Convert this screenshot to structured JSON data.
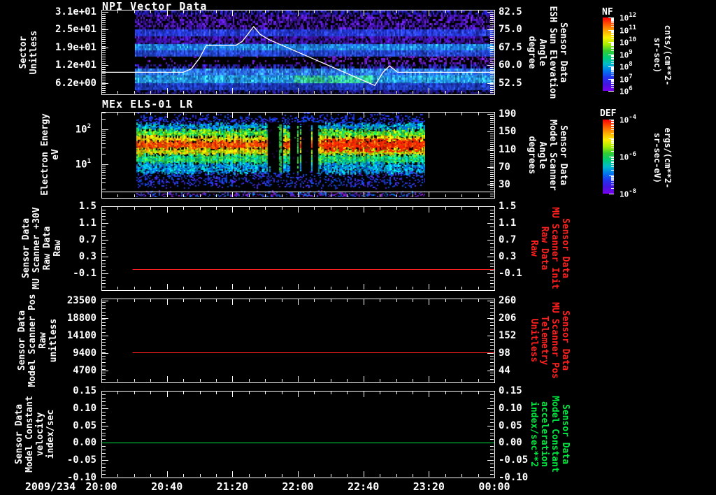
{
  "xaxis": {
    "date_label": "2009/234",
    "tick_labels": [
      "20:00",
      "20:40",
      "21:20",
      "22:00",
      "22:40",
      "23:20",
      "00:00"
    ],
    "tick_minutes": [
      0,
      40,
      80,
      120,
      160,
      200,
      240
    ]
  },
  "panels": [
    {
      "title": "NPI Vector Data",
      "left_label": "Sector\nUnitless",
      "left_ticks": [
        "3.1e+01",
        "2.5e+01",
        "1.9e+01",
        "1.2e+01",
        "6.2e+00"
      ],
      "right_ticks": [
        "82.5",
        "75.0",
        "67.5",
        "60.0",
        "52.5"
      ],
      "right_label": "Sensor Data\nESH Sun Elevation\nAngle\ndegree",
      "right_label_color": "#ffffff"
    },
    {
      "title": "MEx ELS-01 LR",
      "left_label": "Electron Energy\neV",
      "left_ticks": [
        "10^2",
        "10^1"
      ],
      "right_ticks": [
        "190",
        "150",
        "110",
        "70",
        "30"
      ],
      "right_label": "Sensor Data\nModel Scanner\nAngle\ndegrees",
      "right_label_color": "#ffffff"
    },
    {
      "left_label": "Sensor Data\nMU Scanner +30V\nRaw Data\nRaw",
      "left_ticks": [
        "1.5",
        "1.1",
        "0.7",
        "0.3",
        "-0.1"
      ],
      "right_ticks": [
        "1.5",
        "1.1",
        "0.7",
        "0.3",
        "-0.1"
      ],
      "right_label": "Sensor Data\nMU Scanner Init\nRaw Data\nRaw",
      "right_label_color": "#ff2020"
    },
    {
      "left_label": "Sensor Data\nModel Scanner Pos\nRaw\nunitless",
      "left_ticks": [
        "23500",
        "18800",
        "14100",
        "9400",
        "4700"
      ],
      "right_ticks": [
        "260",
        "206",
        "152",
        "98",
        "44"
      ],
      "right_label": "Sensor Data\nMU Scanner Pos\nTelemetry\nUnitless",
      "right_label_color": "#ff2020"
    },
    {
      "left_label": "Sensor Data\nModel Constant\nvelocity\nindex/sec",
      "left_ticks": [
        "0.15",
        "0.10",
        "0.05",
        "0.00",
        "-0.05",
        "-0.10"
      ],
      "right_ticks": [
        "0.15",
        "0.10",
        "0.05",
        "0.00",
        "-0.05",
        "-0.10"
      ],
      "right_label": "Sensor Data\nModel Constant\nacceleration\nindex/sec**2",
      "right_label_color": "#00e840"
    }
  ],
  "colorbars": [
    {
      "title": "NF",
      "ticks": [
        "10^12",
        "10^11",
        "10^10",
        "10^9",
        "10^8",
        "10^7",
        "10^6"
      ],
      "unit": "cnts/(cm**2-sr-sec)",
      "palette": [
        "#7a00ee",
        "#4414dd",
        "#2233ee",
        "#0077ee",
        "#00bbcc",
        "#00cc77",
        "#33cc33",
        "#aaee00",
        "#ffee00",
        "#ffaa00",
        "#ff5500",
        "#ff0000"
      ]
    },
    {
      "title": "DEF",
      "ticks": [
        "10^-4",
        "10^-6",
        "10^-8"
      ],
      "unit": "ergs/(cm**2-sr-sec-eV)",
      "palette": [
        "#7a00ee",
        "#4414dd",
        "#2233ee",
        "#0077ee",
        "#00bbcc",
        "#00cc77",
        "#33cc33",
        "#aaee00",
        "#ffee00",
        "#ffaa00",
        "#ff5500",
        "#ff0000"
      ]
    }
  ],
  "chart_data": [
    {
      "type": "heatmap",
      "title": "NPI Vector Data",
      "xlabel_date": "2009/234",
      "x_ticks": [
        "20:00",
        "20:40",
        "21:20",
        "22:00",
        "22:40",
        "23:20",
        "00:00"
      ],
      "ylabel": "Sector Unitless",
      "y_ticks": [
        6.2,
        12,
        19,
        25,
        31
      ],
      "colorbar": {
        "name": "NF",
        "unit": "cnts/(cm**2-sr-sec)",
        "ticks": [
          1000000.0,
          10000000.0,
          100000000.0,
          1000000000.0,
          10000000000.0,
          100000000000.0,
          1000000000000.0
        ]
      },
      "data_start": "20:20",
      "data_end": "00:00",
      "bands": [
        {
          "f0": 0.0,
          "f1": 0.05,
          "colors": [
            "#2a23c8",
            "#1a14a0",
            "#000000"
          ],
          "density": 0.9
        },
        {
          "f0": 0.05,
          "f1": 0.225,
          "colors": [
            "#4a14b4",
            "#5d1ed0",
            "#2e0c86",
            "#000000",
            "#000000"
          ],
          "density": 1
        },
        {
          "f0": 0.225,
          "f1": 0.315,
          "colors": [
            "#2336d6",
            "#1e2cb8",
            "#2f49e8"
          ],
          "density": 1
        },
        {
          "f0": 0.315,
          "f1": 0.4,
          "colors": [
            "#3d12a6",
            "#4c18c4",
            "#270a74",
            "#000000"
          ],
          "density": 1
        },
        {
          "f0": 0.4,
          "f1": 0.475,
          "colors": [
            "#1f7fe8",
            "#1b65d8",
            "#27a0f0"
          ],
          "density": 1
        },
        {
          "f0": 0.475,
          "f1": 0.55,
          "colors": [
            "#2243cc",
            "#1b34b0",
            "#2a52e0"
          ],
          "density": 1
        },
        {
          "f0": 0.55,
          "f1": 0.645,
          "colors": [
            "#5a14b0",
            "#6a1ecc"
          ],
          "density": 0.08,
          "density2": 0.4
        },
        {
          "f0": 0.645,
          "f1": 0.7,
          "colors": [
            "#3a10a0",
            "#2233bb",
            "#000000"
          ],
          "density": 0.85
        },
        {
          "f0": 0.7,
          "f1": 0.78,
          "colors": [
            "#2b6ff0",
            "#2450d8",
            "#35a0f8"
          ],
          "density": 1
        },
        {
          "f0": 0.78,
          "f1": 0.87,
          "colors": [
            "#2090e0",
            "#1b72d0",
            "#30b8e8"
          ],
          "density": 1,
          "blob": {
            "t0": 0.44,
            "t1": 0.66,
            "color": "#38d892"
          }
        },
        {
          "f0": 0.87,
          "f1": 0.955,
          "colors": [
            "#1c3ab8",
            "#16289c",
            "#2446cc"
          ],
          "density": 1
        },
        {
          "f0": 0.955,
          "f1": 1.0,
          "colors": [
            "#2a1c9c",
            "#17107c",
            "#000000"
          ],
          "density": 0.9
        }
      ],
      "overlay_line": {
        "name": "Sensor Data ESH Sun Elevation Angle (degree)",
        "color": "#ffffff",
        "y_ticks": [
          52.5,
          60.0,
          67.5,
          75.0,
          82.5
        ],
        "points_min_deg": [
          [
            0,
            57
          ],
          [
            50,
            57
          ],
          [
            55,
            58.5
          ],
          [
            60,
            63
          ],
          [
            64,
            68.3
          ],
          [
            82,
            68.3
          ],
          [
            86,
            70
          ],
          [
            93,
            76.3
          ],
          [
            97,
            73
          ],
          [
            102,
            70.9
          ],
          [
            167,
            51.4
          ],
          [
            172,
            57
          ],
          [
            176,
            59.7
          ],
          [
            181,
            57
          ],
          [
            240,
            57
          ]
        ]
      }
    },
    {
      "type": "heatmap",
      "title": "MEx ELS-01 LR",
      "ylabel": "Electron Energy (eV)",
      "yscale": "log",
      "y_ticks": [
        10,
        100
      ],
      "right_axis": {
        "name": "Sensor Data Model Scanner Angle (degrees)",
        "ticks": [
          30,
          70,
          110,
          150,
          190
        ]
      },
      "colorbar": {
        "name": "DEF",
        "unit": "ergs/(cm**2-sr-sec-eV)",
        "ticks": [
          1e-08,
          1e-06,
          0.0001
        ]
      },
      "data_start": "20:21",
      "data_end": "23:18",
      "overlay_line_eV": 1.7,
      "bands": [
        {
          "f0": 0.0,
          "f1": 0.055,
          "colors": [
            "#2233ee",
            "#1a2ccc"
          ],
          "density": 0.12
        },
        {
          "f0": 0.055,
          "f1": 0.135,
          "colors": [
            "#2233ee",
            "#0044cc",
            "#3322dd"
          ],
          "density": 0.45
        },
        {
          "f0": 0.135,
          "f1": 0.205,
          "colors": [
            "#0077dd",
            "#00aacc",
            "#0055ee",
            "#00ccaa"
          ],
          "density": 0.92
        },
        {
          "f0": 0.205,
          "f1": 0.285,
          "colors": [
            "#22cc44",
            "#66dd11",
            "#00cc77",
            "#aaee00"
          ],
          "density": 1
        },
        {
          "f0": 0.285,
          "f1": 0.34,
          "colors": [
            "#ddee00",
            "#ffcc00",
            "#aadd00",
            "#ff9900"
          ],
          "density": 1
        },
        {
          "f0": 0.34,
          "f1": 0.425,
          "colors": [
            "#ff3300",
            "#ff5500",
            "#ee2200",
            "#ff8800"
          ],
          "density": 1
        },
        {
          "f0": 0.425,
          "f1": 0.5,
          "colors": [
            "#ffcc00",
            "#aadd00",
            "#ff9900",
            "#66cc11"
          ],
          "density": 1
        },
        {
          "f0": 0.5,
          "f1": 0.6,
          "colors": [
            "#22cc55",
            "#00cc88",
            "#55dd22",
            "#00bbaa"
          ],
          "density": 1
        },
        {
          "f0": 0.6,
          "f1": 0.715,
          "colors": [
            "#00aadd",
            "#0077dd",
            "#0055cc",
            "#00ccbb"
          ],
          "density": 0.9
        },
        {
          "f0": 0.715,
          "f1": 0.875,
          "colors": [
            "#2233dd",
            "#0044bb",
            "#4422cc"
          ],
          "density": 0.32
        },
        {
          "f0": 0.945,
          "f1": 1.0,
          "colors": [
            "#2233cc",
            "#5522bb",
            "#0066cc",
            "#7711aa"
          ],
          "density": 0.5
        }
      ],
      "regions": [
        {
          "t0": 0.455,
          "t1": 0.625,
          "effect": "gap",
          "f0": 0.1,
          "f1": 0.62,
          "strength": 0.75
        },
        {
          "t0": 0.487,
          "t1": 0.503,
          "effect": "column",
          "color": "#33cc44",
          "f0": 0.13,
          "f1": 0.7
        },
        {
          "t0": 0.543,
          "t1": 0.557,
          "effect": "column",
          "color": "#2fae3a",
          "f0": 0.13,
          "f1": 0.7
        },
        {
          "t0": 0.645,
          "t1": 0.985,
          "effect": "hot",
          "f0": 0.3,
          "f1": 0.46,
          "color": "#ff2200"
        }
      ]
    },
    {
      "type": "line",
      "ylabel": "Sensor Data MU Scanner +30V Raw Data (Raw)",
      "ylim": [
        -0.5,
        1.5
      ],
      "y_ticks": [
        -0.1,
        0.3,
        0.7,
        1.1,
        1.5
      ],
      "right_axis": {
        "name": "Sensor Data MU Scanner Init Raw Data (Raw)",
        "ticks": [
          -0.1,
          0.3,
          0.7,
          1.1,
          1.5
        ],
        "color": "#ff2020"
      },
      "series": [
        {
          "name": "MU Scanner +30V",
          "color": "#ff2020",
          "constant_value": 0.0,
          "start_min": 19,
          "end_min": 240
        }
      ]
    },
    {
      "type": "line",
      "ylabel": "Sensor Data Model Scanner Pos Raw (unitless)",
      "ylim": [
        0,
        23500
      ],
      "y_ticks": [
        4700,
        9400,
        14100,
        18800,
        23500
      ],
      "right_axis": {
        "name": "Sensor Data MU Scanner Pos Telemetry (Unitless)",
        "ticks": [
          44,
          98,
          152,
          206,
          260
        ],
        "color": "#ff2020"
      },
      "series": [
        {
          "name": "Model Scanner Pos",
          "color": "#ff2020",
          "constant_value": 8460,
          "start_min": 19,
          "end_min": 240
        }
      ]
    },
    {
      "type": "line",
      "ylabel": "Sensor Data Model Constant velocity (index/sec)",
      "ylim": [
        -0.1,
        0.15
      ],
      "y_ticks": [
        -0.1,
        -0.05,
        0.0,
        0.05,
        0.1,
        0.15
      ],
      "right_axis": {
        "name": "Sensor Data Model Constant acceleration (index/sec**2)",
        "ticks": [
          -0.1,
          -0.05,
          0.0,
          0.05,
          0.1,
          0.15
        ],
        "color": "#00e840"
      },
      "series": [
        {
          "name": "Model Constant velocity",
          "color": "#00e840",
          "constant_value": 0.0,
          "start_min": 0,
          "end_min": 240
        }
      ]
    }
  ]
}
